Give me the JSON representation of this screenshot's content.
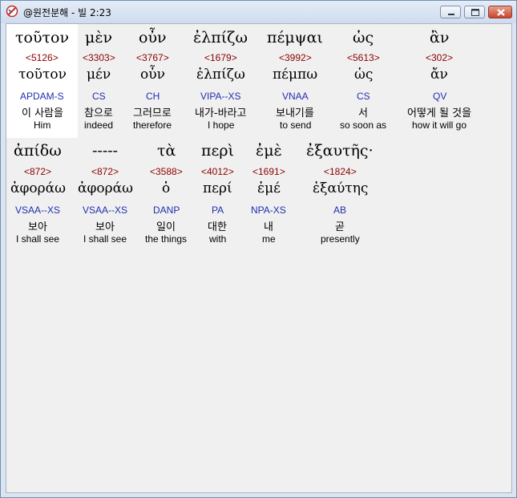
{
  "window": {
    "title": "@원전분해 - 빌 2:23",
    "controls": {
      "minimize": "minimize-icon",
      "maximize": "maximize-icon",
      "close": "close-icon"
    }
  },
  "rows": [
    {
      "words": [
        {
          "greek": "τοῦτον",
          "strong": "<5126>",
          "lemma": "τοῦτον",
          "parse": "APDAM-S",
          "korean": "이 사람을",
          "english": "Him",
          "selected": true
        },
        {
          "greek": "μὲν",
          "strong": "<3303>",
          "lemma": "μέν",
          "parse": "CS",
          "korean": "참으로",
          "english": "indeed"
        },
        {
          "greek": "οὖν",
          "strong": "<3767>",
          "lemma": "οὖν",
          "parse": "CH",
          "korean": "그러므로",
          "english": "therefore"
        },
        {
          "greek": "ἐλπίζω",
          "strong": "<1679>",
          "lemma": "ἐλπίζω",
          "parse": "VIPA--XS",
          "korean": "내가-바라고",
          "english": "I hope"
        },
        {
          "greek": "πέμψαι",
          "strong": "<3992>",
          "lemma": "πέμπω",
          "parse": "VNAA",
          "korean": "보내기를",
          "english": "to send"
        },
        {
          "greek": "ὡς",
          "strong": "<5613>",
          "lemma": "ὡς",
          "parse": "CS",
          "korean": "서",
          "english": "so soon as"
        },
        {
          "greek": "ἂν",
          "strong": "<302>",
          "lemma": "ἄν",
          "parse": "QV",
          "korean": "어떻게 될 것을",
          "english": "how it will go"
        }
      ]
    },
    {
      "words": [
        {
          "greek": "ἀπίδω",
          "strong": "<872>",
          "lemma": "ἀφοράω",
          "parse": "VSAA--XS",
          "korean": "보아",
          "english": "I shall see"
        },
        {
          "greek": "-----",
          "strong": "<872>",
          "lemma": "ἀφοράω",
          "parse": "VSAA--XS",
          "korean": "보아",
          "english": "I shall see"
        },
        {
          "greek": "τὰ",
          "strong": "<3588>",
          "lemma": "ὁ",
          "parse": "DANP",
          "korean": "일이",
          "english": "the things"
        },
        {
          "greek": "περὶ",
          "strong": "<4012>",
          "lemma": "περί",
          "parse": "PA",
          "korean": "대한",
          "english": "with"
        },
        {
          "greek": "ἐμὲ",
          "strong": "<1691>",
          "lemma": "ἐμέ",
          "parse": "NPA-XS",
          "korean": "내",
          "english": "me"
        },
        {
          "greek": "ἐξαυτῆς·",
          "strong": "<1824>",
          "lemma": "ἐξαύτης",
          "parse": "AB",
          "korean": "곧",
          "english": "presently"
        }
      ]
    }
  ]
}
